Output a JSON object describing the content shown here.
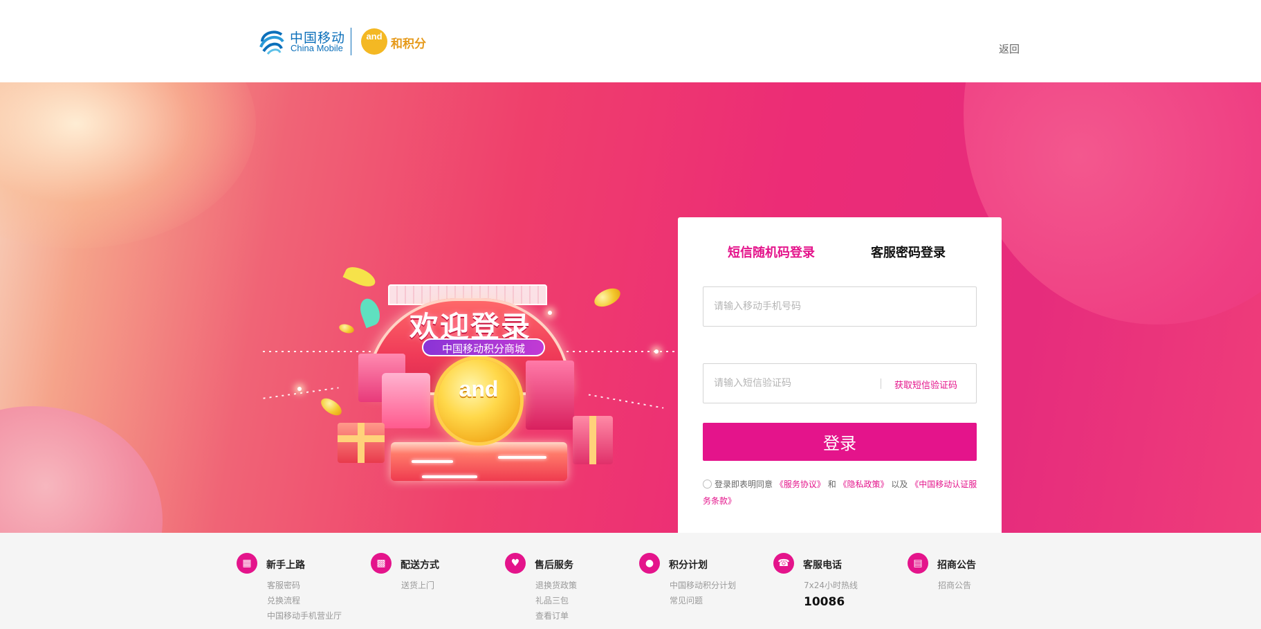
{
  "header": {
    "brand_cn": "中国移动",
    "brand_en": "China Mobile",
    "badge": "and",
    "points_brand": "和积分",
    "back": "返回"
  },
  "banner": {
    "welcome": "欢迎登录",
    "subtitle": "中国移动积分商城",
    "coin_text": "and"
  },
  "login": {
    "tabs": [
      {
        "label": "短信随机码登录",
        "active": true
      },
      {
        "label": "客服密码登录",
        "active": false
      }
    ],
    "phone_placeholder": "请输入移动手机号码",
    "code_placeholder": "请输入短信验证码",
    "get_code": "获取短信验证码",
    "submit": "登录",
    "agreement": {
      "prefix": "登录即表明同意",
      "service": "《服务协议》",
      "and": "和",
      "privacy": "《隐私政策》",
      "also": "以及",
      "auth": "《中国移动认证服务条款》"
    }
  },
  "footer": {
    "columns": [
      {
        "icon": "guide-icon",
        "title": "新手上路",
        "links": [
          "客服密码",
          "兑换流程",
          "中国移动手机营业厅"
        ]
      },
      {
        "icon": "truck-icon",
        "title": "配送方式",
        "links": [
          "送货上门"
        ]
      },
      {
        "icon": "hand-heart-icon",
        "title": "售后服务",
        "links": [
          "退换货政策",
          "礼品三包",
          "查看订单"
        ]
      },
      {
        "icon": "coins-icon",
        "title": "积分计划",
        "links": [
          "中国移动积分计划",
          "常见问题"
        ]
      },
      {
        "icon": "phone-icon",
        "title": "客服电话",
        "links": [
          "7x24小时热线"
        ],
        "phone": "10086"
      },
      {
        "icon": "notice-icon",
        "title": "招商公告",
        "links": [
          "招商公告"
        ]
      }
    ]
  },
  "colors": {
    "accent": "#e4148b",
    "brand_blue": "#0b6fba",
    "points_gold": "#e69a1b"
  }
}
